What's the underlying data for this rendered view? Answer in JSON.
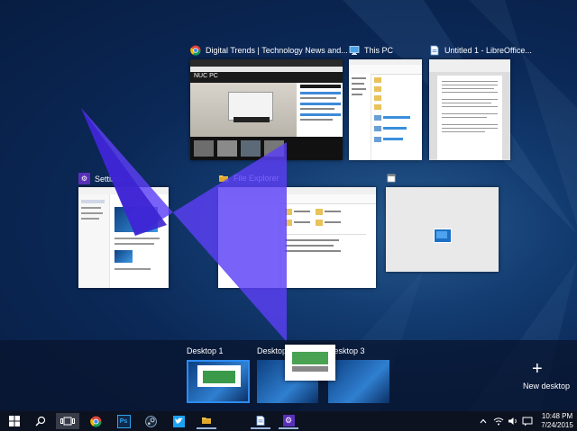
{
  "windows": [
    {
      "title": "Digital Trends | Technology News and..."
    },
    {
      "title": "This PC"
    },
    {
      "title": "Untitled 1 - LibreOffice..."
    },
    {
      "title": "Settings"
    },
    {
      "title": "File Explorer"
    },
    {
      "title": ""
    }
  ],
  "digital_trends": {
    "heading": "NUC PC"
  },
  "desktops": [
    {
      "label": "Desktop 1"
    },
    {
      "label": "Desktop 2"
    },
    {
      "label": "Desktop 3"
    }
  ],
  "new_desktop": {
    "label": "New desktop",
    "plus": "+"
  },
  "clock": {
    "time": "10:48 PM",
    "date": "7/24/2015"
  },
  "colors": {
    "accent": "#5b3ff5",
    "settings_icon": "#5a2fb8",
    "selection": "#2d8cf0"
  },
  "icons": [
    "windows-start-icon",
    "search-icon",
    "task-view-icon",
    "chrome-icon",
    "photoshop-icon",
    "steam-icon",
    "twitter-icon",
    "file-explorer-icon",
    "document-icon",
    "settings-icon"
  ]
}
